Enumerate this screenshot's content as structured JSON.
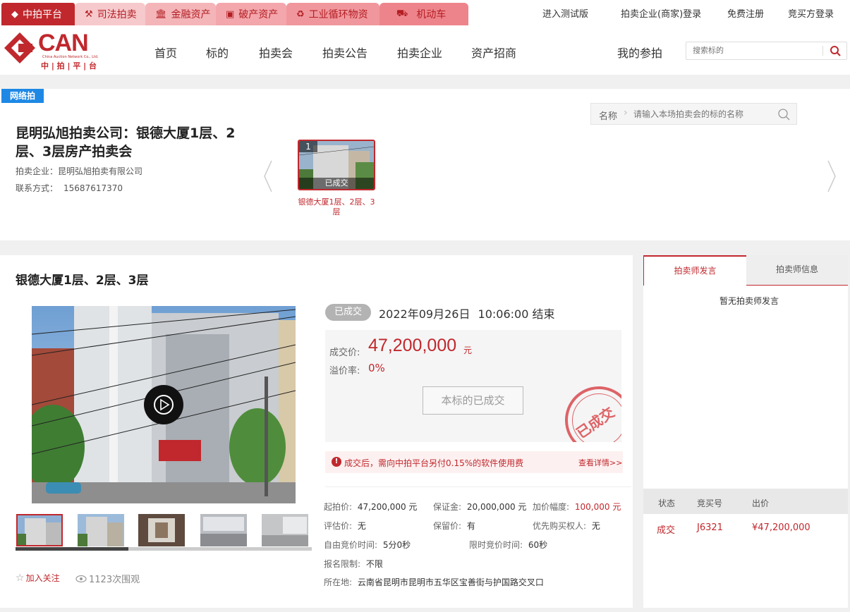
{
  "platform_tabs": [
    {
      "label": "中拍平台",
      "icon": "logo-icon"
    },
    {
      "label": "司法拍卖",
      "icon": "hammer-icon"
    },
    {
      "label": "金融资产",
      "icon": "bank-icon"
    },
    {
      "label": "破产资产",
      "icon": "cash-icon"
    },
    {
      "label": "工业循环物资",
      "icon": "recycle-icon"
    },
    {
      "label": "机动车",
      "icon": "car-icon"
    }
  ],
  "top_links": [
    "进入测试版",
    "拍卖企业(商家)登录",
    "免费注册",
    "竞买方登录"
  ],
  "logo": {
    "main": "CAN",
    "sub": "China Auction Network Co., Ltd.",
    "cn": "中 | 拍 | 平 | 台"
  },
  "nav": [
    "首页",
    "标的",
    "拍卖会",
    "拍卖公告",
    "拍卖企业",
    "资产招商"
  ],
  "my_bids": "我的参拍",
  "search_placeholder": "搜索标的",
  "session": {
    "badge": "网络拍",
    "title": "昆明弘旭拍卖公司：银德大厦1层、2层、3层房产拍卖会",
    "company_label": "拍卖企业：",
    "company": "昆明弘旭拍卖有限公司",
    "contact_label": "联系方式：",
    "contact": "15687617370",
    "filter_label": "名称",
    "filter_placeholder": "请输入本场拍卖会的标的名称",
    "lot_number": "1",
    "lot_status": "已成交",
    "lot_name": "银德大厦1层、2层、3层"
  },
  "lot": {
    "title": "银德大厦1层、2层、3层",
    "status_badge": "已成交",
    "end_date": "2022年09月26日",
    "end_time": "10:06:00 结束",
    "deal_label": "成交价:",
    "deal_price": "47,200,000",
    "deal_unit": "元",
    "premium_label": "溢价率:",
    "premium": "0%",
    "deal_button": "本标的已成交",
    "stamp": "已成交",
    "notice": "成交后，需向中拍平台另付0.15%的软件使用费",
    "notice_link": "查看详情>>",
    "follow": "加入关注",
    "views": "1123次围观",
    "details": {
      "start_label": "起拍价:",
      "start": "47,200,000 元",
      "deposit_label": "保证金:",
      "deposit": "20,000,000 元",
      "increment_label": "加价幅度:",
      "increment": "100,000 元",
      "appraisal_label": "评估价:",
      "appraisal": "无",
      "reserve_label": "保留价:",
      "reserve": "有",
      "priority_label": "优先购买权人:",
      "priority": "无",
      "free_time_label": "自由竞价时间:",
      "free_time": "5分0秒",
      "limit_time_label": "限时竞价时间:",
      "limit_time": "60秒",
      "reg_label": "报名限制:",
      "reg": "不限",
      "location_label": "所在地:",
      "location": "云南省昆明市昆明市五华区宝善街与护国路交叉口"
    }
  },
  "side": {
    "tabs": [
      "拍卖师发言",
      "拍卖师信息"
    ],
    "empty": "暂无拍卖师发言",
    "columns": [
      "状态",
      "竞买号",
      "出价"
    ],
    "rows": [
      {
        "status": "成交",
        "bidder": "J6321",
        "price": "¥47,200,000"
      }
    ]
  },
  "colors": {
    "brand": "#c0282d",
    "accent_blue": "#1e88e5"
  }
}
